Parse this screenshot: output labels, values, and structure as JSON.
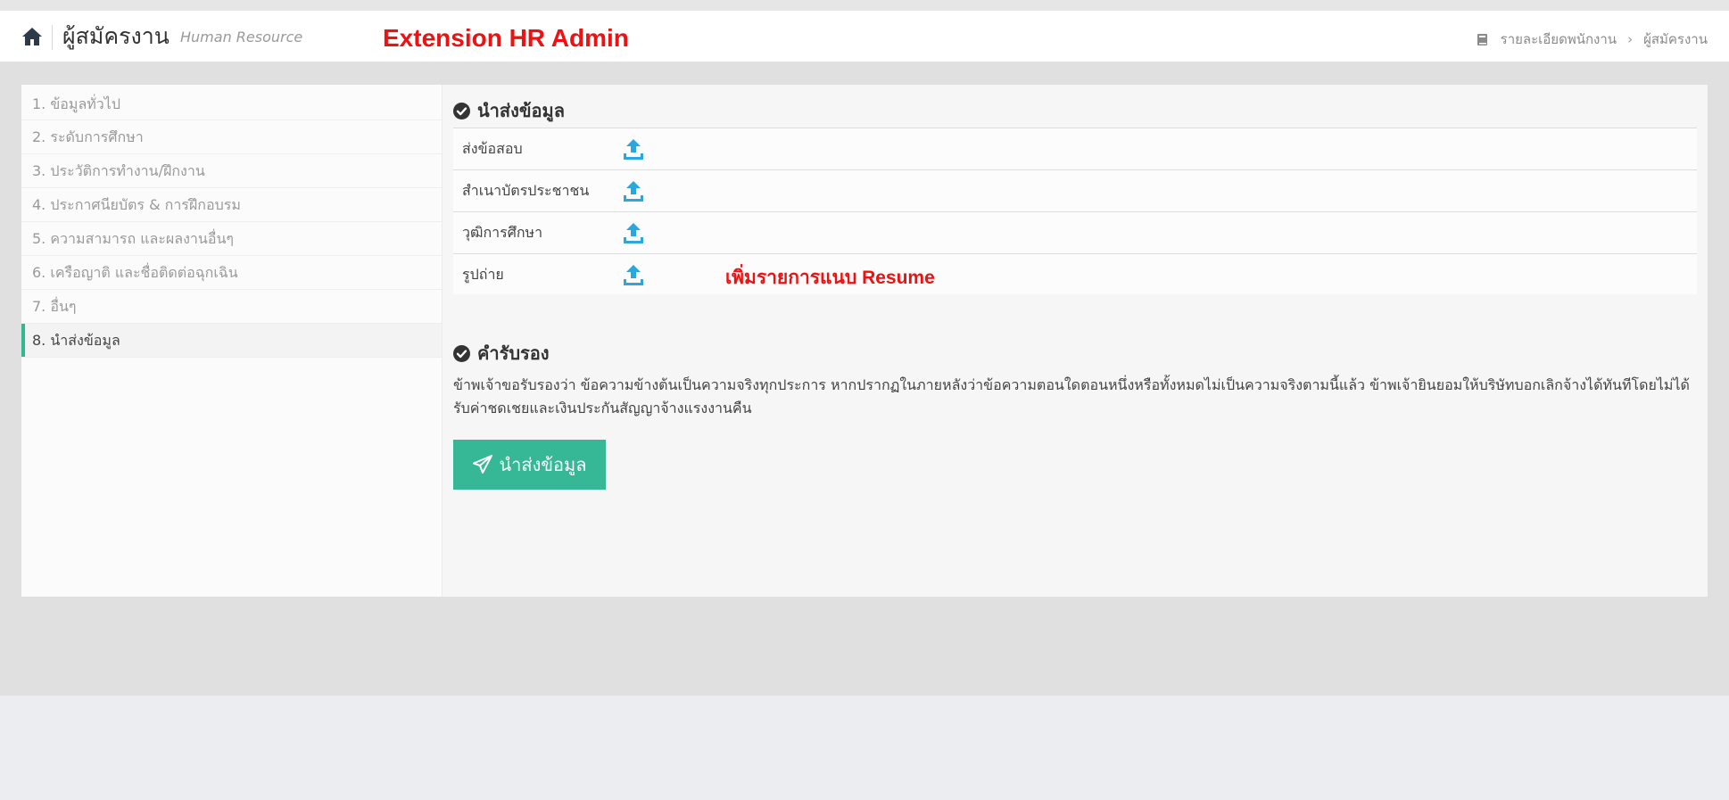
{
  "header": {
    "title": "ผู้สมัครงาน",
    "subtitle": "Human Resource",
    "overlay_title": "Extension HR Admin",
    "breadcrumb": [
      "รายละเอียดพนักงาน",
      "ผู้สมัครงาน"
    ],
    "breadcrumb_separator": "›"
  },
  "sidebar": {
    "items": [
      {
        "label": "1. ข้อมูลทั่วไป",
        "active": false
      },
      {
        "label": "2. ระดับการศึกษา",
        "active": false
      },
      {
        "label": "3. ประวัติการทำงาน/ฝึกงาน",
        "active": false
      },
      {
        "label": "4. ประกาศนียบัตร & การฝึกอบรม",
        "active": false
      },
      {
        "label": "5. ความสามารถ และผลงานอื่นๆ",
        "active": false
      },
      {
        "label": "6. เครือญาติ และชื่อติดต่อฉุกเฉิน",
        "active": false
      },
      {
        "label": "7. อื่นๆ",
        "active": false
      },
      {
        "label": "8. นำส่งข้อมูล",
        "active": true
      }
    ]
  },
  "upload_section": {
    "title": "นำส่งข้อมูล",
    "rows": [
      {
        "label": "ส่งข้อสอบ",
        "icon": "upload-icon"
      },
      {
        "label": "สำเนาบัตรประชาชน",
        "icon": "upload-icon"
      },
      {
        "label": "วุฒิการศึกษา",
        "icon": "upload-icon"
      },
      {
        "label": "รูปถ่าย",
        "icon": "upload-icon"
      }
    ],
    "note": "เพิ่มรายการแนบ Resume"
  },
  "certification": {
    "title": "คำรับรอง",
    "text": "ข้าพเจ้าขอรับรองว่า ข้อความข้างต้นเป็นความจริงทุกประการ หากปรากฏในภายหลังว่าข้อความตอนใดตอนหนึ่งหรือทั้งหมดไม่เป็นความจริงตามนี้แล้ว ข้าพเจ้ายินยอมให้บริษัทบอกเลิกจ้างได้ทันทีโดยไม่ได้รับค่าชดเชยและเงินประกันสัญญาจ้างแรงงานคืน"
  },
  "submit_button": {
    "label": "นำส่งข้อมูล",
    "icon": "paper-plane-icon"
  },
  "colors": {
    "accent": "#36b795",
    "upload_icon": "#2aa7dd",
    "overlay_text": "#ee1111"
  }
}
